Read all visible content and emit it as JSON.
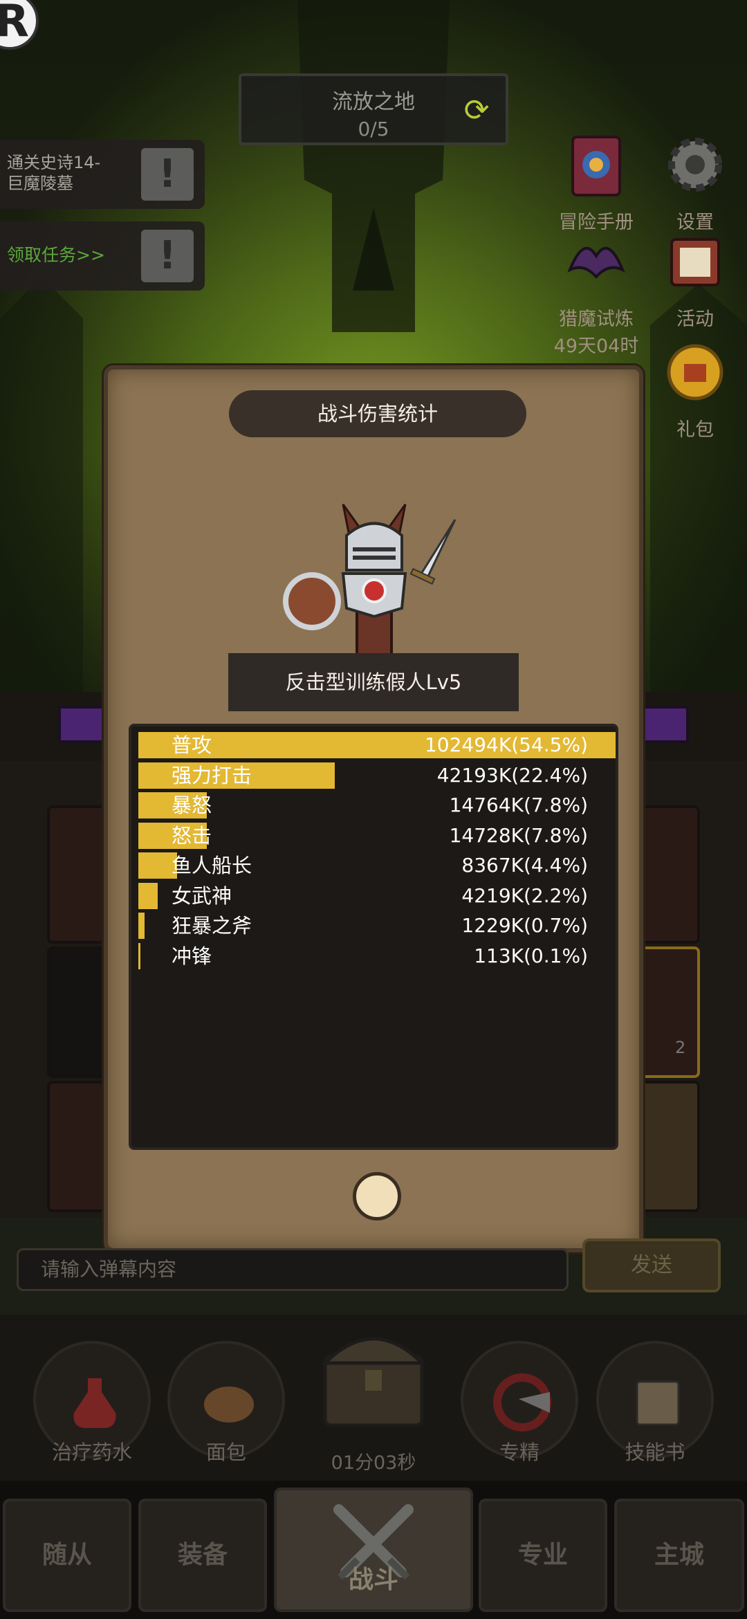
{
  "top": {
    "logo_letter": "R",
    "stage_name": "流放之地",
    "stage_progress": "0/5"
  },
  "quests": [
    {
      "line1": "通关史诗14-",
      "line2": "巨魔陵墓"
    },
    {
      "line1": "领取任务>>",
      "line2": ""
    }
  ],
  "side_buttons": {
    "handbook": "冒险手册",
    "settings": "设置",
    "hunt_line1": "猎魔试炼",
    "hunt_line2": "49天04时",
    "event": "活动",
    "gift": "礼包"
  },
  "modal": {
    "title": "战斗伤害统计",
    "target_name": "反击型训练假人Lv5",
    "stats": [
      {
        "name": "普攻",
        "value": "102494K(54.5%)",
        "percent": 54.5
      },
      {
        "name": "强力打击",
        "value": "42193K(22.4%)",
        "percent": 22.4
      },
      {
        "name": "暴怒",
        "value": "14764K(7.8%)",
        "percent": 7.8
      },
      {
        "name": "怒击",
        "value": "14728K(7.8%)",
        "percent": 7.8
      },
      {
        "name": "鱼人船长",
        "value": "8367K(4.4%)",
        "percent": 4.4
      },
      {
        "name": "女武神",
        "value": "4219K(2.2%)",
        "percent": 2.2
      },
      {
        "name": "狂暴之斧",
        "value": "1229K(0.7%)",
        "percent": 0.7
      },
      {
        "name": "冲锋",
        "value": "113K(0.1%)",
        "percent": 0.1
      }
    ]
  },
  "background_badge": "2",
  "chat": {
    "placeholder": "请输入弹幕内容",
    "send_label": "发送"
  },
  "items": {
    "potion": "治疗药水",
    "bread": "面包",
    "chest_timer": "01分03秒",
    "specialty": "专精",
    "skill_book": "技能书"
  },
  "nav": {
    "followers": "随从",
    "equipment": "装备",
    "battle": "战斗",
    "profession": "专业",
    "main_city": "主城"
  },
  "colors": {
    "damage_bar": "#e3b833",
    "modal_bg": "#8b7353",
    "panel_bg": "#1c1916"
  }
}
